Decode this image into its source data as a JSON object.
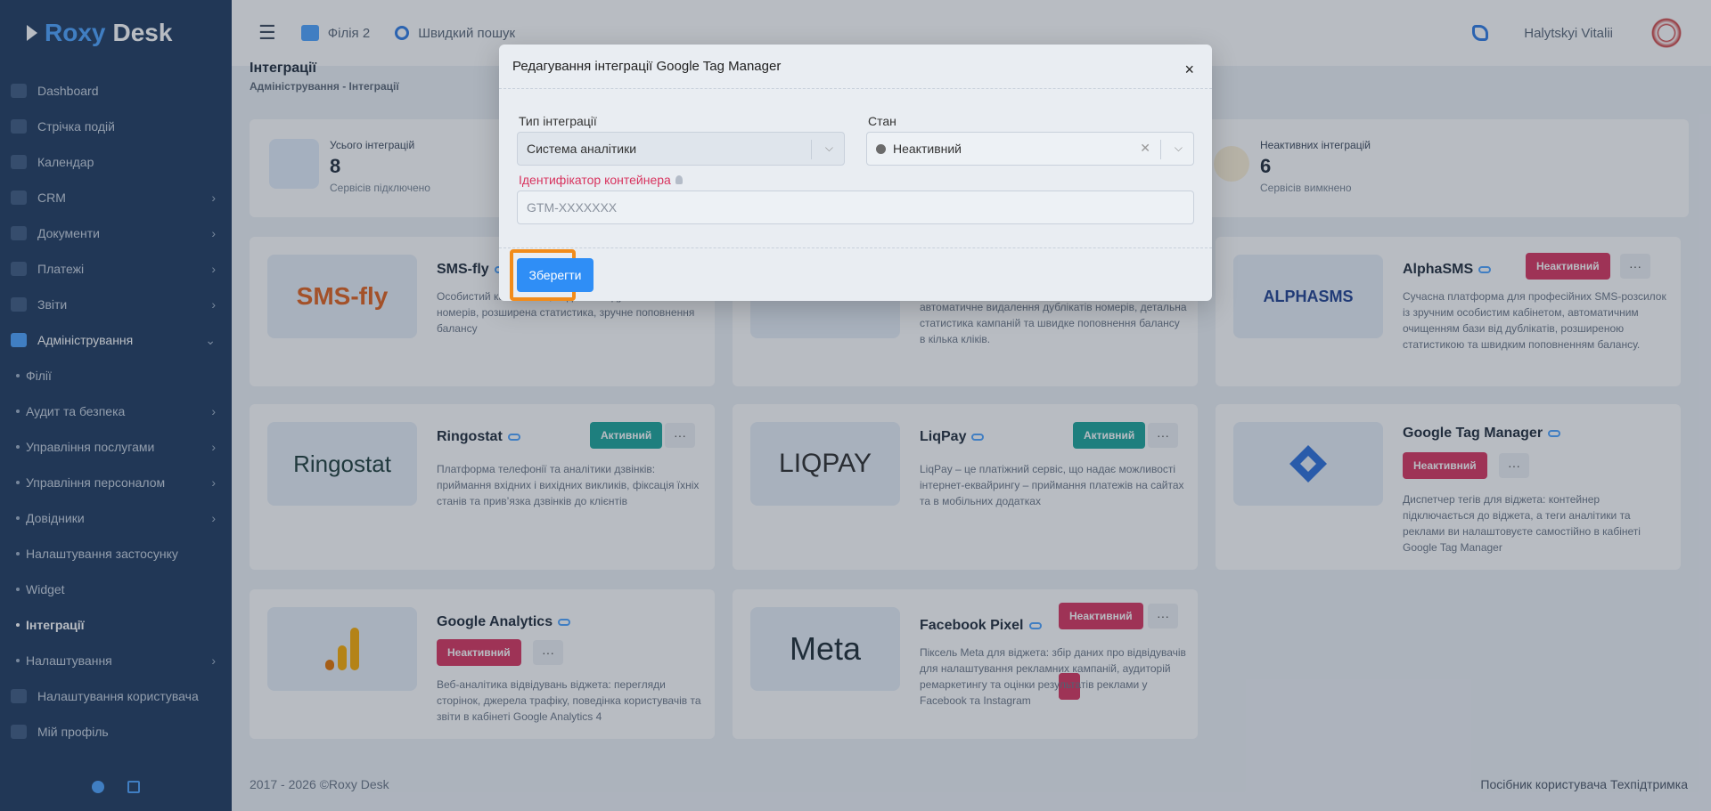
{
  "app": {
    "brand_prefix": "Roxy",
    "brand_suffix": "Desk"
  },
  "sidebar": {
    "items": [
      {
        "label": "Dashboard",
        "icon": "dashboard-icon"
      },
      {
        "label": "Стрічка подій",
        "icon": "feed-icon"
      },
      {
        "label": "Календар",
        "icon": "calendar-icon"
      },
      {
        "label": "CRM",
        "icon": "crm-icon"
      },
      {
        "label": "Документи",
        "icon": "document-icon"
      },
      {
        "label": "Платежі",
        "icon": "payment-icon"
      },
      {
        "label": "Звіти",
        "icon": "report-icon"
      },
      {
        "label": "Адміністрування",
        "icon": "tools-icon"
      },
      {
        "label": "Філії"
      },
      {
        "label": "Аудит та безпека"
      },
      {
        "label": "Управління послугами"
      },
      {
        "label": "Управління персоналом"
      },
      {
        "label": "Довідники"
      },
      {
        "label": "Налаштування застосунку"
      },
      {
        "label": "Widget"
      },
      {
        "label": "Інтеграції"
      },
      {
        "label": "Налаштування"
      },
      {
        "label": "Налаштування користувача",
        "icon": "user-settings-icon"
      },
      {
        "label": "Мій профіль",
        "icon": "profile-icon"
      }
    ]
  },
  "topbar": {
    "branch": "Філія 2",
    "search_placeholder": "Швидкий пошук",
    "user_name": "Halytskyi Vitalii"
  },
  "page": {
    "title": "Інтеграції",
    "breadcrumb": "Адміністрування - Інтеграції"
  },
  "stats": [
    {
      "label": "Усього інтеграцій",
      "value": "8",
      "sub": "Сервісів підключено"
    },
    {
      "label": "Неактивних інтеграцій",
      "value": "6",
      "sub": "Сервісів вимкнено"
    }
  ],
  "cards": [
    {
      "title": "SMS-fly",
      "logo": "SMS-fly",
      "desc": "Особистий кабінет з ..., видалення дублікатів номерів, розширена статистика, зручне поповнення балансу"
    },
    {
      "title": "",
      "logo": "",
      "desc": "над SMS-розсилками: гнучкі налаштування, автоматичне видалення дублікатів номерів, детальна статистика кампаній та швидке поповнення балансу в кілька кліків."
    },
    {
      "title": "AlphaSMS",
      "logo": "ALPHASMS",
      "badge": "Неактивний",
      "desc": "Сучасна платформа для професійних SMS-розсилок із зручним особистим кабінетом, автоматичним очищенням бази від дублікатів, розширеною статистикою та швидким поповненням балансу."
    },
    {
      "title": "Ringostat",
      "logo": "Ringostat",
      "badge": "Активний",
      "desc": "Платформа телефонії та аналітики дзвінків: приймання вхідних і вихідних викликів, фіксація їхніх станів та прив’язка дзвінків до клієнтів"
    },
    {
      "title": "LiqPay",
      "logo": "LIQPAY",
      "badge": "Активний",
      "desc": "LiqPay – це платіжний сервіс, що надає можливості інтернет-еквайрингу – приймання платежів на сайтах та в мобільних додатках"
    },
    {
      "title": "Google Tag Manager",
      "logo": "",
      "badge": "Неактивний",
      "desc": "Диспетчер тегів для віджета: контейнер підключається до віджета, а теги аналітики та реклами ви налаштовуєте самостійно в кабінеті Google Tag Manager"
    },
    {
      "title": "Google Analytics",
      "logo": "",
      "badge": "Неактивний",
      "desc": "Веб-аналітика відвідувань віджета: перегляди сторінок, джерела трафіку, поведінка користувачів та звіти в кабінеті Google Analytics 4"
    },
    {
      "title": "Facebook Pixel",
      "logo": "Meta",
      "badge": "Неактивний",
      "desc": "Піксель Meta для віджета: збір даних про відвідувачів для налаштування рекламних кампаній, аудиторій ремаркетингу та оцінки результатів реклами у Facebook та Instagram"
    }
  ],
  "more_label": "···",
  "footer": {
    "copyright": "2017 - 2026 ©Roxy Desk",
    "guide": "Посібник користувача",
    "support": "Техпідтримка"
  },
  "modal": {
    "title": "Редагування інтеграції Google Tag Manager",
    "close": "×",
    "type_label": "Тип інтеграції",
    "type_value": "Система аналітики",
    "state_label": "Стан",
    "state_value": "Неактивний",
    "container_label": "Ідентифікатор контейнера",
    "container_placeholder": "GTM-XXXXXXX",
    "save_label": "Зберегти"
  }
}
